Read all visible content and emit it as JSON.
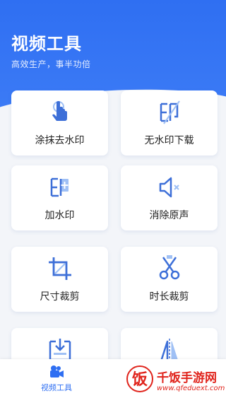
{
  "header": {
    "title": "视频工具",
    "subtitle": "高效生产，事半功倍"
  },
  "tools": [
    {
      "label": "涂抹去水印",
      "icon": "tap-finger-icon"
    },
    {
      "label": "无水印下载",
      "icon": "stamp-slash-icon"
    },
    {
      "label": "加水印",
      "icon": "stamp-plus-icon"
    },
    {
      "label": "消除原声",
      "icon": "speaker-mute-icon"
    },
    {
      "label": "尺寸裁剪",
      "icon": "crop-icon"
    },
    {
      "label": "时长裁剪",
      "icon": "scissors-icon"
    },
    {
      "label": "",
      "icon": "download-frame-icon"
    },
    {
      "label": "",
      "icon": "mirror-icon"
    }
  ],
  "bottom_nav": {
    "tabs": [
      {
        "label": "视频工具",
        "icon": "video-camera-icon",
        "active": true
      }
    ]
  },
  "watermark": {
    "logo_char": "饭",
    "title": "千饭手游网",
    "url": "www.qfeduext.com"
  },
  "colors": {
    "primary": "#2f6ff2",
    "icon_blue": "#3d6fd8",
    "icon_light": "#9fc0f5",
    "watermark_red": "#e0241c"
  }
}
